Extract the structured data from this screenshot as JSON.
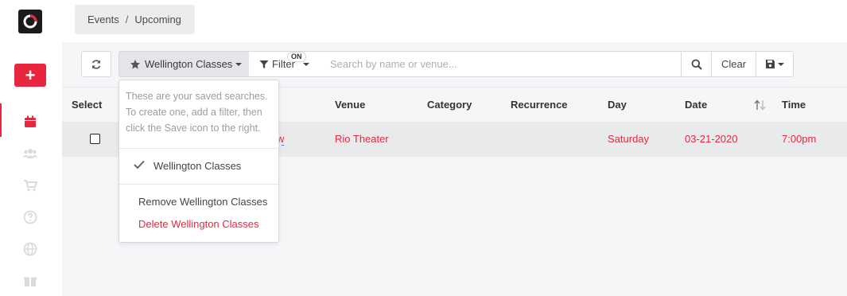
{
  "breadcrumb": {
    "items": [
      "Events",
      "Upcoming"
    ],
    "separator": "/"
  },
  "sidebar": {
    "add_label": "+",
    "icons": [
      "calendar-icon",
      "users-icon",
      "cart-icon",
      "help-icon",
      "globe-icon",
      "gift-icon"
    ]
  },
  "toolbar": {
    "refresh_icon": "refresh-icon",
    "saved_search_label": "Wellington Classes",
    "filter_label": "Filter",
    "filter_badge": "ON",
    "search_placeholder": "Search by name or venue...",
    "clear_label": "Clear"
  },
  "dropdown": {
    "hint": "These are your saved searches. To create one, add a filter, then click the Save icon to the right.",
    "checked_item": "Wellington Classes",
    "remove_label": "Remove Wellington Classes",
    "delete_label": "Delete Wellington Classes"
  },
  "table": {
    "headers": {
      "select": "Select",
      "venue": "Venue",
      "category": "Category",
      "recurrence": "Recurrence",
      "day": "Day",
      "date": "Date",
      "time": "Time"
    },
    "rows": [
      {
        "name_fragment": "w",
        "venue": "Rio Theater",
        "category": "",
        "recurrence": "",
        "day": "Saturday",
        "date": "03-21-2020",
        "time": "7:00pm"
      }
    ]
  },
  "colors": {
    "accent": "#e8273f",
    "background": "#f5f6f8"
  }
}
